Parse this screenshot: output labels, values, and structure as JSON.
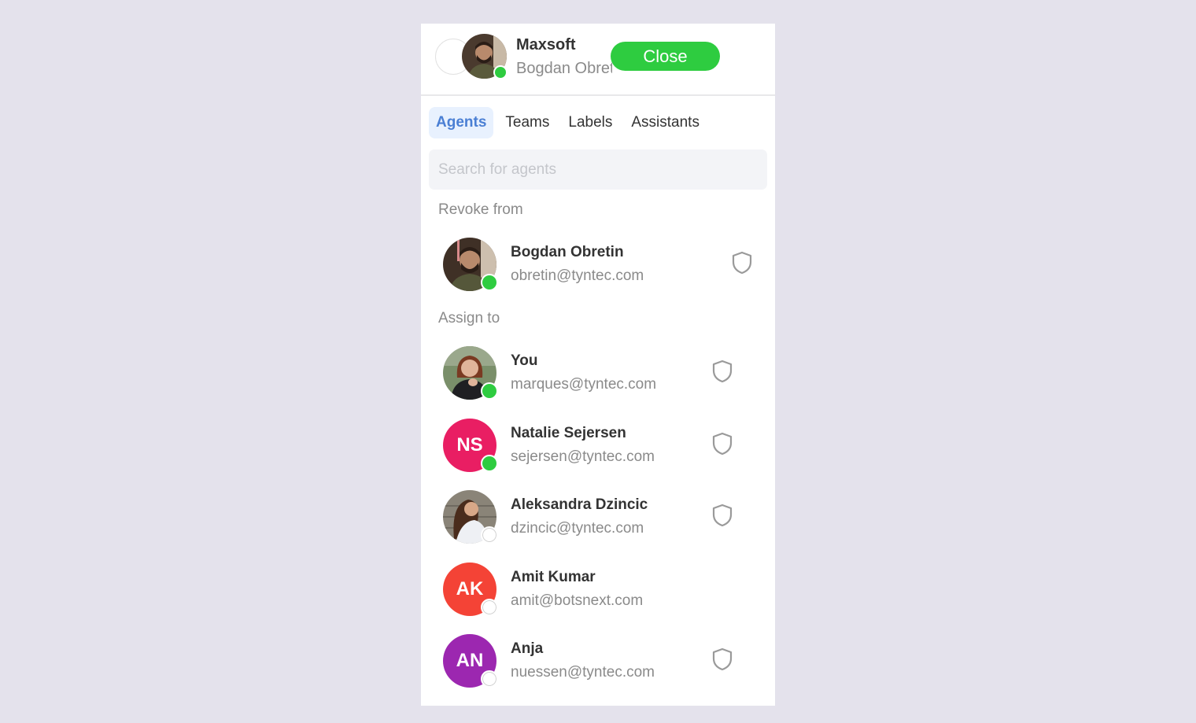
{
  "header": {
    "title": "Maxsoft",
    "subtitle": "Bogdan Obretin",
    "close_label": "Close",
    "status": "online"
  },
  "tabs": [
    {
      "label": "Agents",
      "active": true
    },
    {
      "label": "Teams",
      "active": false
    },
    {
      "label": "Labels",
      "active": false
    },
    {
      "label": "Assistants",
      "active": false
    }
  ],
  "search": {
    "placeholder": "Search for agents",
    "value": ""
  },
  "sections": {
    "revoke_label": "Revoke from",
    "assign_label": "Assign to"
  },
  "revoke_agents": [
    {
      "name": "Bogdan Obretin",
      "email": "obretin@tyntec.com",
      "status": "online",
      "avatar": "photo",
      "shield": true
    }
  ],
  "assign_agents": [
    {
      "name": "You",
      "email": "marques@tyntec.com",
      "status": "online",
      "avatar": "photo",
      "shield": true
    },
    {
      "name": "Natalie Sejersen",
      "email": "sejersen@tyntec.com",
      "status": "online",
      "initials": "NS",
      "color": "#e91e63",
      "shield": true
    },
    {
      "name": "Aleksandra Dzincic",
      "email": "dzincic@tyntec.com",
      "status": "offline",
      "avatar": "photo",
      "shield": true
    },
    {
      "name": "Amit Kumar",
      "email": "amit@botsnext.com",
      "status": "offline",
      "initials": "AK",
      "color": "#f44336",
      "shield": false
    },
    {
      "name": "Anja",
      "email": "nuessen@tyntec.com",
      "status": "offline",
      "initials": "AN",
      "color": "#9c27b0",
      "shield": true
    }
  ],
  "colors": {
    "accent_green": "#2ecc40",
    "tab_active_text": "#4a7fd4",
    "tab_active_bg": "#e8f1fe"
  }
}
